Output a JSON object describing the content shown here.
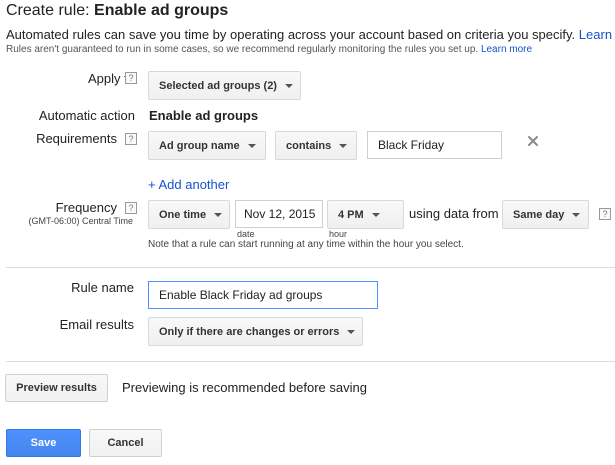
{
  "header": {
    "title_prefix": "Create rule:",
    "title_name": "Enable ad groups",
    "intro": "Automated rules can save you time by operating across your account based on criteria you specify.",
    "intro_link": "Learn",
    "note": "Rules aren't guaranteed to run in some cases, so we recommend regularly monitoring the rules you set up.",
    "note_link": "Learn more"
  },
  "apply_to": {
    "label": "Apply to",
    "help": "?",
    "value": "Selected ad groups (2)"
  },
  "automatic_action": {
    "label": "Automatic action",
    "value": "Enable ad groups"
  },
  "requirements": {
    "label": "Requirements",
    "help": "?",
    "field": "Ad group name",
    "operator": "contains",
    "value": "Black Friday",
    "remove_icon": "close-icon",
    "add_another": "+ Add another"
  },
  "frequency": {
    "label": "Frequency",
    "help": "?",
    "timezone": "(GMT-06:00) Central Time",
    "value": "One time",
    "date": "Nov 12, 2015",
    "date_caption": "date",
    "hour": "4 PM",
    "hour_caption": "hour",
    "using_text": "using data from",
    "data_range": "Same day",
    "range_help": "?",
    "note": "Note that a rule can start running at any time within the hour you select."
  },
  "rule_name": {
    "label": "Rule name",
    "value": "Enable Black Friday ad groups"
  },
  "email_results": {
    "label": "Email results",
    "value": "Only if there are changes or errors"
  },
  "preview": {
    "button": "Preview results",
    "message": "Previewing is recommended before saving"
  },
  "footer": {
    "save": "Save",
    "cancel": "Cancel"
  },
  "colors": {
    "primary": "#4d90fe",
    "link": "#1155cc"
  }
}
